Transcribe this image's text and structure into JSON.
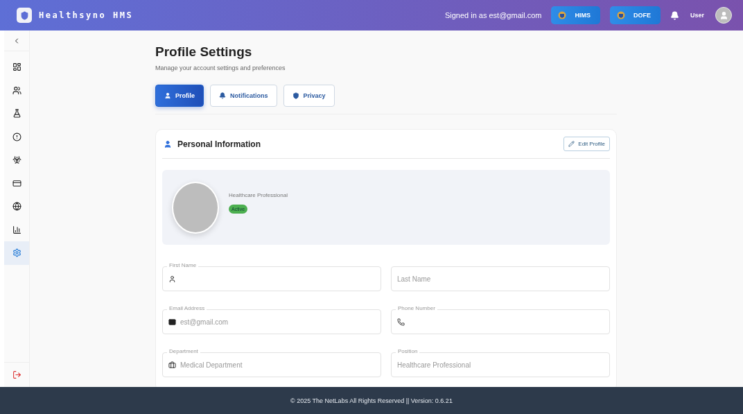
{
  "header": {
    "brand": "Healthsyno HMS",
    "signed_in": "Signed in as est@gmail.com",
    "apps": [
      {
        "label": "HIMS"
      },
      {
        "label": "DOFE"
      }
    ],
    "user": "User"
  },
  "sidebar": {
    "items": [
      {
        "selected": false
      },
      {
        "selected": false
      },
      {
        "selected": false
      },
      {
        "selected": false
      },
      {
        "selected": false
      },
      {
        "selected": false
      },
      {
        "selected": false
      },
      {
        "selected": false
      },
      {
        "selected": true
      }
    ]
  },
  "page": {
    "title": "Profile Settings",
    "subtitle": "Manage your account settings and preferences"
  },
  "tabs": [
    {
      "label": "Profile",
      "selected": true
    },
    {
      "label": "Notifications",
      "selected": false
    },
    {
      "label": "Privacy",
      "selected": false
    }
  ],
  "card": {
    "title": "Personal Information",
    "edit_button": "Edit Profile",
    "role": "Healthcare Professional",
    "status": "Active",
    "fields": [
      {
        "label": "First Name"
      },
      {
        "placeholder": "Last Name"
      },
      {
        "label": "Email Address",
        "value": "est@gmail.com"
      },
      {
        "label": "Phone Number"
      },
      {
        "label": "Department",
        "value": "Medical Department"
      },
      {
        "label": "Position",
        "value": "Healthcare Professional"
      }
    ]
  },
  "footer": "© 2025 The NetLabs All Rights Reserved || Version: 0.6.21"
}
